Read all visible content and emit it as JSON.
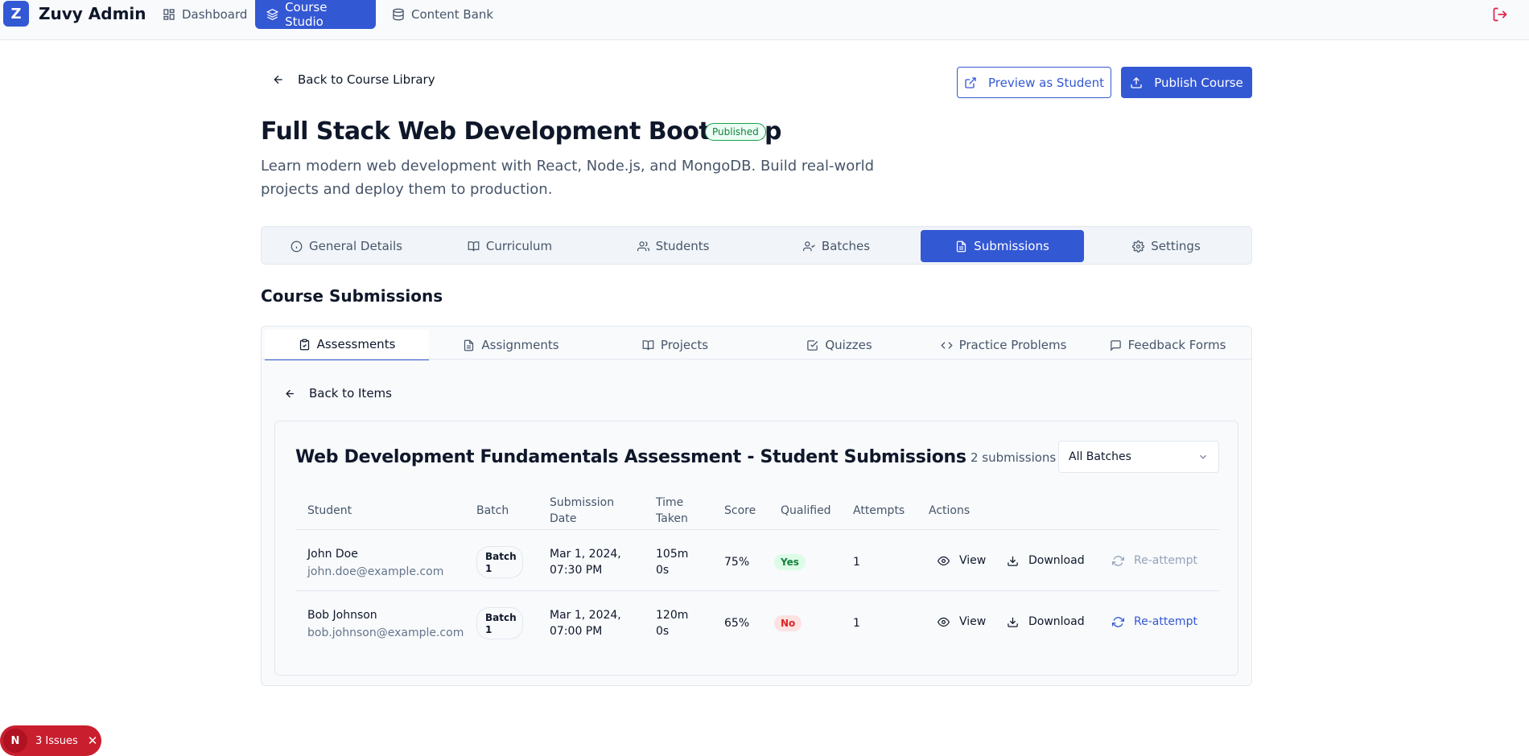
{
  "app": {
    "logo_letter": "Z",
    "name": "Zuvy Admin"
  },
  "nav": {
    "items": [
      {
        "label": "Dashboard",
        "icon": "dashboard-icon"
      },
      {
        "label": "Course Studio",
        "icon": "layers-icon",
        "active": true
      },
      {
        "label": "Content Bank",
        "icon": "database-icon"
      }
    ]
  },
  "header": {
    "back_label": "Back to Course Library",
    "preview_label": "Preview as Student",
    "publish_label": "Publish Course",
    "course_title": "Full Stack Web Development Bootcamp",
    "status_badge": "Published",
    "description": "Learn modern web development with React, Node.js, and MongoDB. Build real-world projects and deploy them to production."
  },
  "main_tabs": [
    {
      "label": "General Details",
      "icon": "info-icon"
    },
    {
      "label": "Curriculum",
      "icon": "book-open-icon"
    },
    {
      "label": "Students",
      "icon": "users-icon"
    },
    {
      "label": "Batches",
      "icon": "user-check-icon"
    },
    {
      "label": "Submissions",
      "icon": "file-text-icon",
      "active": true
    },
    {
      "label": "Settings",
      "icon": "gear-icon"
    }
  ],
  "section_title": "Course Submissions",
  "sub_tabs": [
    {
      "label": "Assessments",
      "icon": "clipboard-check-icon",
      "active": true
    },
    {
      "label": "Assignments",
      "icon": "file-text-icon"
    },
    {
      "label": "Projects",
      "icon": "book-open-icon"
    },
    {
      "label": "Quizzes",
      "icon": "check-square-icon"
    },
    {
      "label": "Practice Problems",
      "icon": "code-icon"
    },
    {
      "label": "Feedback Forms",
      "icon": "message-square-icon"
    }
  ],
  "back_items_label": "Back to Items",
  "card": {
    "title": "Web Development Fundamentals Assessment - Student Submissions",
    "count_label": "2 submissions",
    "batch_filter": "All Batches"
  },
  "table": {
    "headers": {
      "student": "Student",
      "batch": "Batch",
      "submission_date_1": "Submission",
      "submission_date_2": "Date",
      "time_taken_1": "Time",
      "time_taken_2": "Taken",
      "score": "Score",
      "qualified": "Qualified",
      "attempts": "Attempts",
      "actions": "Actions"
    },
    "rows": [
      {
        "name": "John Doe",
        "email": "john.doe@example.com",
        "batch_1": "Batch",
        "batch_2": "1",
        "date_1": "Mar 1, 2024,",
        "date_2": "07:30 PM",
        "time_1": "105m",
        "time_2": "0s",
        "score": "75%",
        "qualified": "Yes",
        "attempts": "1",
        "view": "View",
        "download": "Download",
        "reattempt": "Re-attempt",
        "reattempt_enabled": false
      },
      {
        "name": "Bob Johnson",
        "email": "bob.johnson@example.com",
        "batch_1": "Batch",
        "batch_2": "1",
        "date_1": "Mar 1, 2024,",
        "date_2": "07:00 PM",
        "time_1": "120m",
        "time_2": "0s",
        "score": "65%",
        "qualified": "No",
        "attempts": "1",
        "view": "View",
        "download": "Download",
        "reattempt": "Re-attempt",
        "reattempt_enabled": true
      }
    ]
  },
  "issues_toast": {
    "logo_letter": "N",
    "label": "3 Issues",
    "close": "✕"
  },
  "colors": {
    "primary": "#3358d4",
    "danger": "#dc2626",
    "success": "#15803d"
  }
}
